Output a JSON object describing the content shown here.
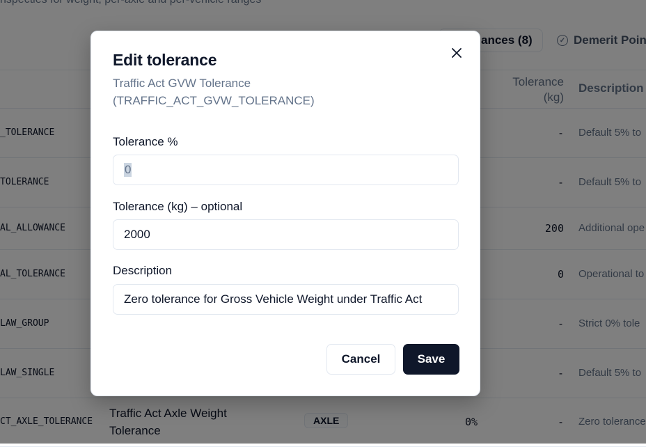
{
  "background": {
    "top_text": "nspecties for weight, per-axle and per-vehicle ranges",
    "tabs": {
      "tolerances_label": "ances (8)",
      "demerit_label": "Demerit Poin"
    },
    "table_header": {
      "tolerance_kg": "Tolerance (kg)",
      "description": "Description"
    },
    "rows": [
      {
        "code": "_TOLERANCE",
        "name": "",
        "badge": "",
        "pct": "",
        "kg": "-",
        "desc": "Default 5% to"
      },
      {
        "code": "TOLERANCE",
        "name": "",
        "badge": "",
        "pct": "",
        "kg": "-",
        "desc": "Default 5% to"
      },
      {
        "code": "AL_ALLOWANCE",
        "name": "",
        "badge": "",
        "pct": "",
        "kg": "200",
        "desc": "Additional ope"
      },
      {
        "code": "AL_TOLERANCE",
        "name": "",
        "badge": "",
        "pct": "",
        "kg": "0",
        "desc": "Operational to"
      },
      {
        "code": "LAW_GROUP",
        "name": "",
        "badge": "",
        "pct": "",
        "kg": "-",
        "desc": "Strict 0% tole"
      },
      {
        "code": "LAW_SINGLE",
        "name": "",
        "badge": "",
        "pct": "",
        "kg": "-",
        "desc": "Default 5% to"
      },
      {
        "code": "CT_AXLE_TOLERANCE",
        "name": "Traffic Act Axle Weight Tolerance",
        "badge": "AXLE",
        "pct": "0%",
        "kg": "-",
        "desc": "Zero tolerance"
      }
    ]
  },
  "modal": {
    "title": "Edit tolerance",
    "subtitle": "Traffic Act GVW Tolerance (TRAFFIC_ACT_GVW_TOLERANCE)",
    "tolerance_pct": {
      "label": "Tolerance %",
      "value": "0"
    },
    "tolerance_kg": {
      "label": "Tolerance (kg) – optional",
      "value": "2000"
    },
    "description": {
      "label": "Description",
      "value": "Zero tolerance for Gross Vehicle Weight under Traffic Act"
    },
    "cancel_label": "Cancel",
    "save_label": "Save"
  },
  "colors": {
    "primary": "#0f172a",
    "muted": "#64748b",
    "border": "#e2e8f0"
  }
}
